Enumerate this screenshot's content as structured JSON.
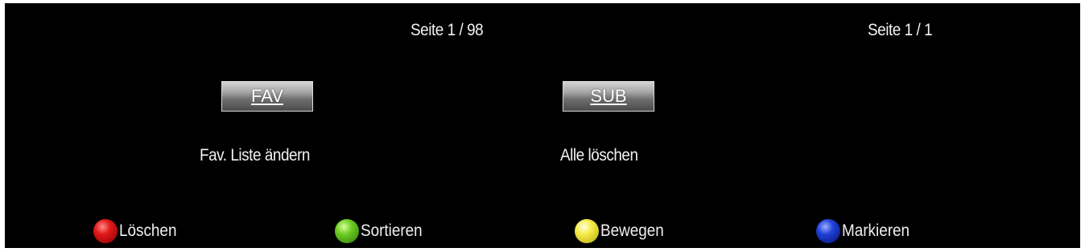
{
  "pages": {
    "left": "Seite 1 / 98",
    "right": "Seite 1 / 1"
  },
  "buttons": {
    "fav": {
      "label": "FAV",
      "description": "Fav. Liste ändern"
    },
    "sub": {
      "label": "SUB",
      "description": "Alle löschen"
    }
  },
  "legend": [
    {
      "label": "Löschen",
      "icon": "red-circle-icon",
      "color": "#d01010"
    },
    {
      "label": "Sortieren",
      "icon": "green-circle-icon",
      "color": "#58c018"
    },
    {
      "label": "Bewegen",
      "icon": "yellow-circle-icon",
      "color": "#f2e830"
    },
    {
      "label": "Markieren",
      "icon": "blue-circle-icon",
      "color": "#1430c8"
    }
  ]
}
